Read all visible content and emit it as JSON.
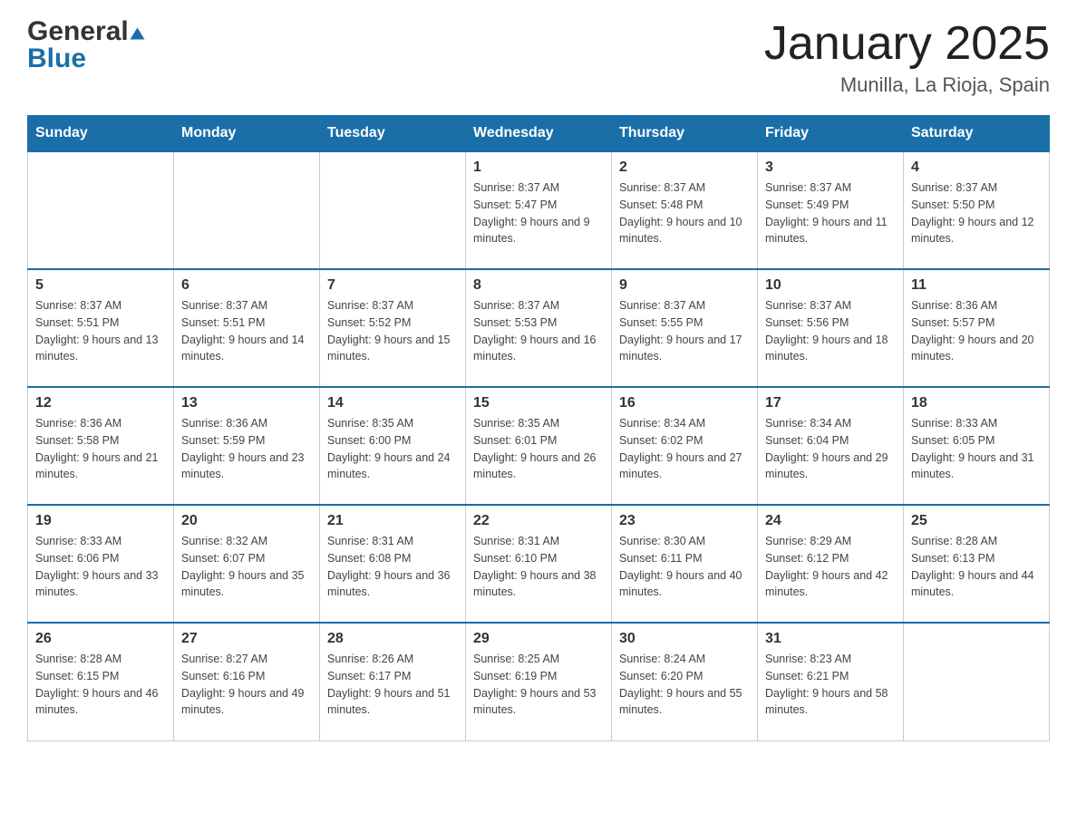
{
  "header": {
    "logo_line1": "General",
    "logo_line2": "Blue",
    "title": "January 2025",
    "subtitle": "Munilla, La Rioja, Spain"
  },
  "days_of_week": [
    "Sunday",
    "Monday",
    "Tuesday",
    "Wednesday",
    "Thursday",
    "Friday",
    "Saturday"
  ],
  "weeks": [
    [
      {
        "day": "",
        "info": ""
      },
      {
        "day": "",
        "info": ""
      },
      {
        "day": "",
        "info": ""
      },
      {
        "day": "1",
        "info": "Sunrise: 8:37 AM\nSunset: 5:47 PM\nDaylight: 9 hours and 9 minutes."
      },
      {
        "day": "2",
        "info": "Sunrise: 8:37 AM\nSunset: 5:48 PM\nDaylight: 9 hours and 10 minutes."
      },
      {
        "day": "3",
        "info": "Sunrise: 8:37 AM\nSunset: 5:49 PM\nDaylight: 9 hours and 11 minutes."
      },
      {
        "day": "4",
        "info": "Sunrise: 8:37 AM\nSunset: 5:50 PM\nDaylight: 9 hours and 12 minutes."
      }
    ],
    [
      {
        "day": "5",
        "info": "Sunrise: 8:37 AM\nSunset: 5:51 PM\nDaylight: 9 hours and 13 minutes."
      },
      {
        "day": "6",
        "info": "Sunrise: 8:37 AM\nSunset: 5:51 PM\nDaylight: 9 hours and 14 minutes."
      },
      {
        "day": "7",
        "info": "Sunrise: 8:37 AM\nSunset: 5:52 PM\nDaylight: 9 hours and 15 minutes."
      },
      {
        "day": "8",
        "info": "Sunrise: 8:37 AM\nSunset: 5:53 PM\nDaylight: 9 hours and 16 minutes."
      },
      {
        "day": "9",
        "info": "Sunrise: 8:37 AM\nSunset: 5:55 PM\nDaylight: 9 hours and 17 minutes."
      },
      {
        "day": "10",
        "info": "Sunrise: 8:37 AM\nSunset: 5:56 PM\nDaylight: 9 hours and 18 minutes."
      },
      {
        "day": "11",
        "info": "Sunrise: 8:36 AM\nSunset: 5:57 PM\nDaylight: 9 hours and 20 minutes."
      }
    ],
    [
      {
        "day": "12",
        "info": "Sunrise: 8:36 AM\nSunset: 5:58 PM\nDaylight: 9 hours and 21 minutes."
      },
      {
        "day": "13",
        "info": "Sunrise: 8:36 AM\nSunset: 5:59 PM\nDaylight: 9 hours and 23 minutes."
      },
      {
        "day": "14",
        "info": "Sunrise: 8:35 AM\nSunset: 6:00 PM\nDaylight: 9 hours and 24 minutes."
      },
      {
        "day": "15",
        "info": "Sunrise: 8:35 AM\nSunset: 6:01 PM\nDaylight: 9 hours and 26 minutes."
      },
      {
        "day": "16",
        "info": "Sunrise: 8:34 AM\nSunset: 6:02 PM\nDaylight: 9 hours and 27 minutes."
      },
      {
        "day": "17",
        "info": "Sunrise: 8:34 AM\nSunset: 6:04 PM\nDaylight: 9 hours and 29 minutes."
      },
      {
        "day": "18",
        "info": "Sunrise: 8:33 AM\nSunset: 6:05 PM\nDaylight: 9 hours and 31 minutes."
      }
    ],
    [
      {
        "day": "19",
        "info": "Sunrise: 8:33 AM\nSunset: 6:06 PM\nDaylight: 9 hours and 33 minutes."
      },
      {
        "day": "20",
        "info": "Sunrise: 8:32 AM\nSunset: 6:07 PM\nDaylight: 9 hours and 35 minutes."
      },
      {
        "day": "21",
        "info": "Sunrise: 8:31 AM\nSunset: 6:08 PM\nDaylight: 9 hours and 36 minutes."
      },
      {
        "day": "22",
        "info": "Sunrise: 8:31 AM\nSunset: 6:10 PM\nDaylight: 9 hours and 38 minutes."
      },
      {
        "day": "23",
        "info": "Sunrise: 8:30 AM\nSunset: 6:11 PM\nDaylight: 9 hours and 40 minutes."
      },
      {
        "day": "24",
        "info": "Sunrise: 8:29 AM\nSunset: 6:12 PM\nDaylight: 9 hours and 42 minutes."
      },
      {
        "day": "25",
        "info": "Sunrise: 8:28 AM\nSunset: 6:13 PM\nDaylight: 9 hours and 44 minutes."
      }
    ],
    [
      {
        "day": "26",
        "info": "Sunrise: 8:28 AM\nSunset: 6:15 PM\nDaylight: 9 hours and 46 minutes."
      },
      {
        "day": "27",
        "info": "Sunrise: 8:27 AM\nSunset: 6:16 PM\nDaylight: 9 hours and 49 minutes."
      },
      {
        "day": "28",
        "info": "Sunrise: 8:26 AM\nSunset: 6:17 PM\nDaylight: 9 hours and 51 minutes."
      },
      {
        "day": "29",
        "info": "Sunrise: 8:25 AM\nSunset: 6:19 PM\nDaylight: 9 hours and 53 minutes."
      },
      {
        "day": "30",
        "info": "Sunrise: 8:24 AM\nSunset: 6:20 PM\nDaylight: 9 hours and 55 minutes."
      },
      {
        "day": "31",
        "info": "Sunrise: 8:23 AM\nSunset: 6:21 PM\nDaylight: 9 hours and 58 minutes."
      },
      {
        "day": "",
        "info": ""
      }
    ]
  ]
}
